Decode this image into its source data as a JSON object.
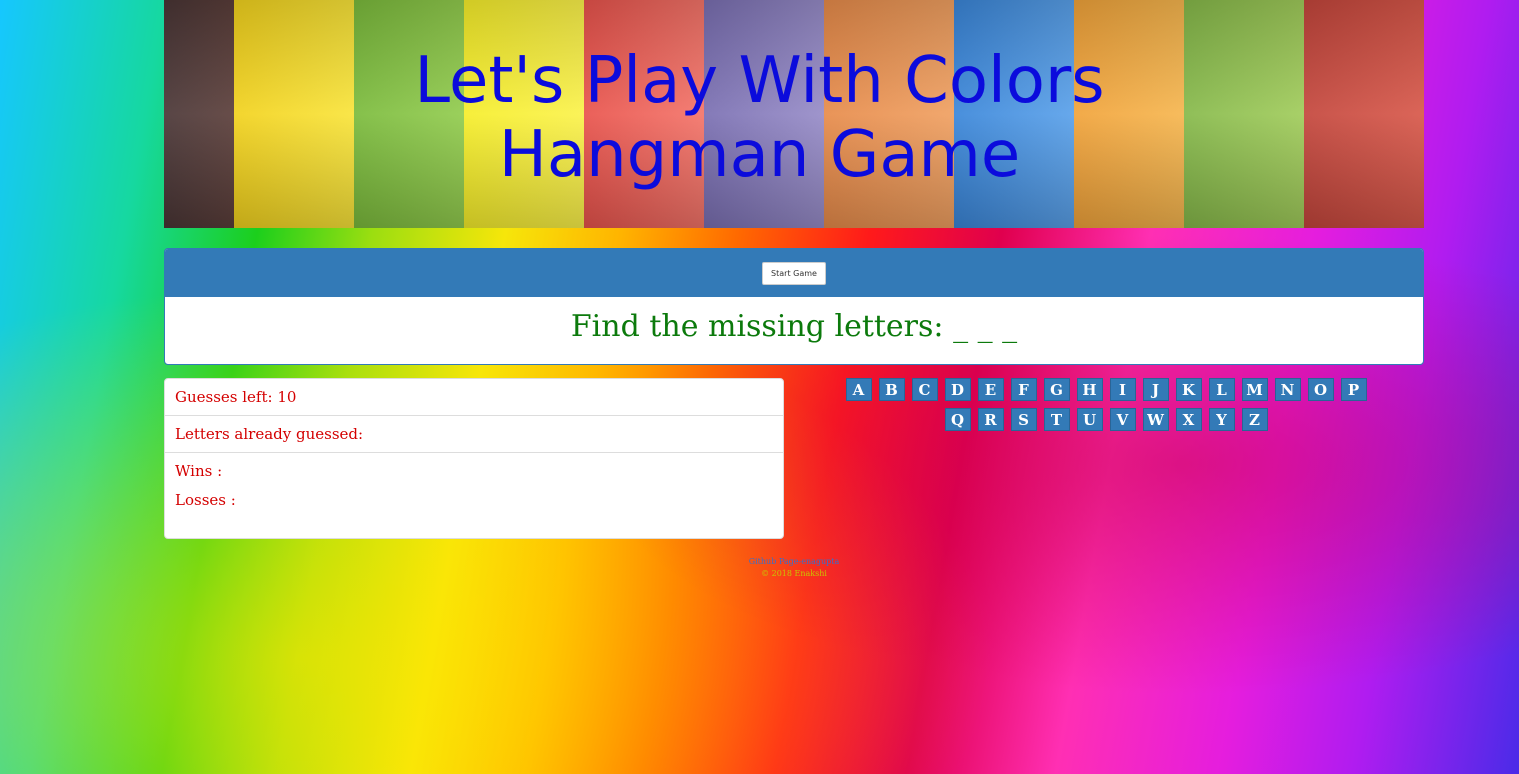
{
  "header": {
    "title_line1": "Let's Play With Colors",
    "title_line2": "Hangman Game"
  },
  "controls": {
    "start_label": "Start Game"
  },
  "puzzle": {
    "prompt": "Find the missing letters: _ _ _"
  },
  "stats": {
    "guesses_left": "Guesses left: 10",
    "letters_guessed": "Letters already guessed:",
    "wins": "Wins :",
    "losses": "Losses :"
  },
  "keyboard": {
    "letters": [
      "A",
      "B",
      "C",
      "D",
      "E",
      "F",
      "G",
      "H",
      "I",
      "J",
      "K",
      "L",
      "M",
      "N",
      "O",
      "P",
      "Q",
      "R",
      "S",
      "T",
      "U",
      "V",
      "W",
      "X",
      "Y",
      "Z"
    ]
  },
  "footer": {
    "github": "Github Page-enagupta",
    "copyright": "© 2018 Enakshi"
  },
  "colors": {
    "title": "#0b0bdc",
    "prompt": "#0c7a0c",
    "stats": "#d40000",
    "key_bg": "#337ab7"
  }
}
